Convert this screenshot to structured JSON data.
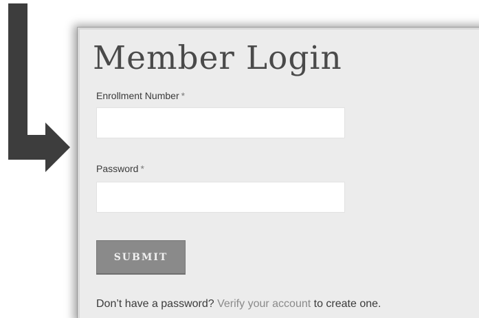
{
  "login": {
    "title": "Member Login",
    "enrollment_label": "Enrollment Number",
    "enrollment_required_mark": "*",
    "enrollment_value": "",
    "password_label": "Password",
    "password_required_mark": "*",
    "password_value": "",
    "submit_label": "SUBMIT",
    "footer_prefix": "Don’t have a password?",
    "footer_link": "Verify your account",
    "footer_suffix": "to create one."
  },
  "colors": {
    "arrow": "#3a3a3a",
    "panel_bg": "#ececec",
    "button_bg": "#8a8a8a",
    "link": "#8a8a8a"
  },
  "icons": {
    "arrow": "l-shaped-arrow-icon"
  }
}
